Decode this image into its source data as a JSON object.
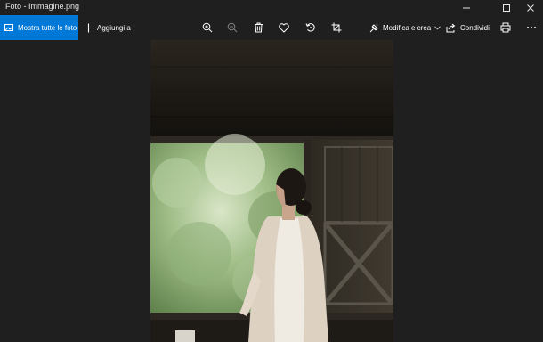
{
  "window": {
    "title": "Foto - Immagine.png",
    "minimize_icon": "minimize-icon",
    "maximize_icon": "maximize-icon",
    "close_icon": "close-icon"
  },
  "toolbar": {
    "show_all_label": "Mostra tutte le foto",
    "add_to_label": "Aggiungi a",
    "zoom_in_icon": "zoom-in-icon",
    "zoom_out_icon": "zoom-out-icon",
    "delete_icon": "trash-icon",
    "favorite_icon": "heart-icon",
    "rotate_icon": "rotate-icon",
    "crop_icon": "crop-icon",
    "edit_create_label": "Modifica e crea",
    "share_label": "Condividi",
    "print_icon": "print-icon",
    "more_icon": "more-icon"
  },
  "colors": {
    "accent": "#0078d7",
    "background": "#1f1f1f",
    "text": "#ffffff"
  }
}
